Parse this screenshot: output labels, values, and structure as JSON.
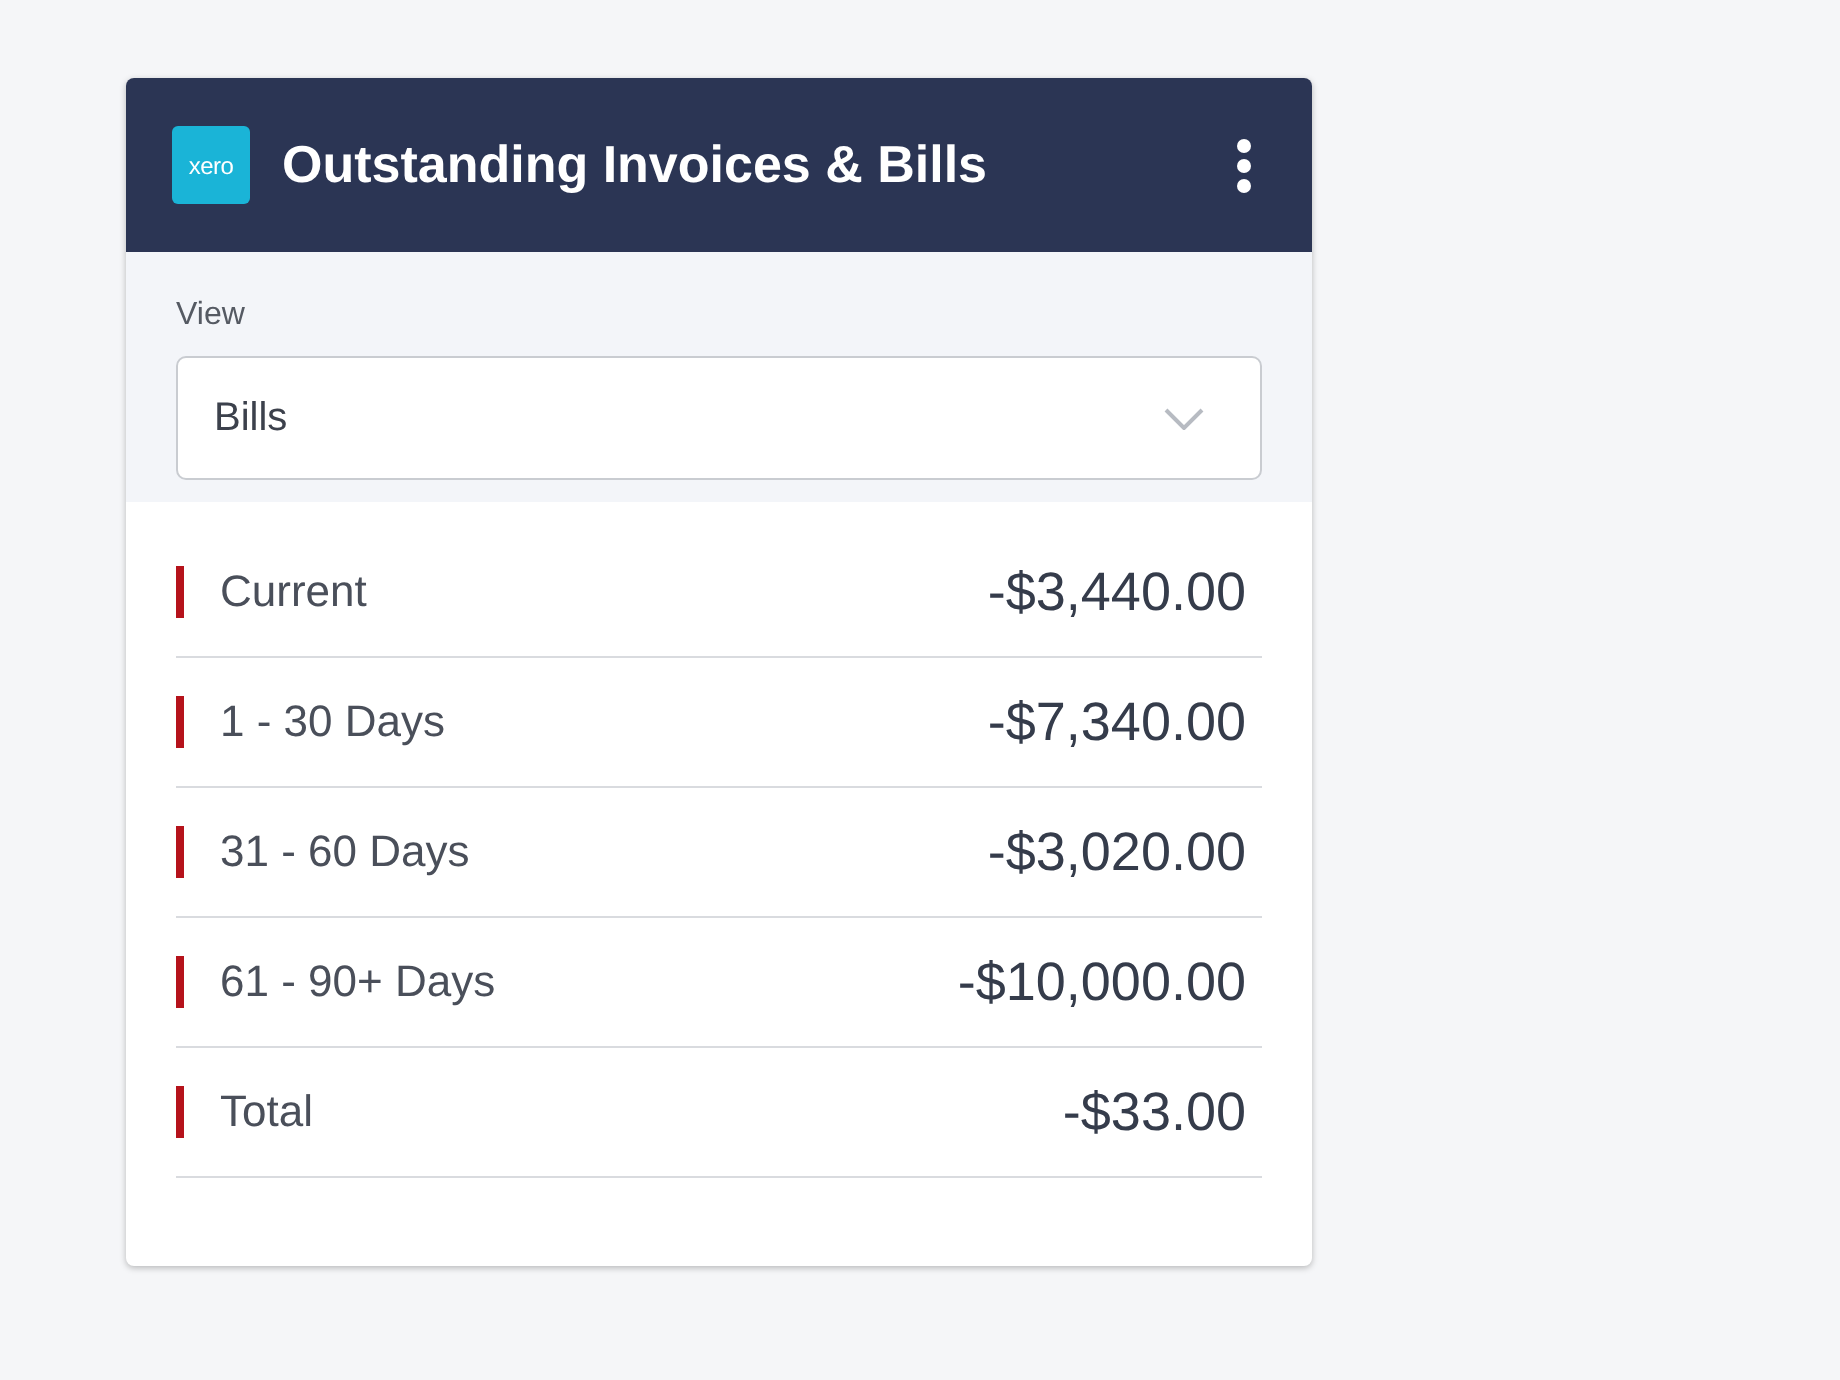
{
  "header": {
    "logo": "xero",
    "title": "Outstanding Invoices & Bills"
  },
  "filter": {
    "label": "View",
    "value": "Bills"
  },
  "rows": [
    {
      "label": "Current",
      "amount": "-$3,440.00"
    },
    {
      "label": "1 - 30 Days",
      "amount": "-$7,340.00"
    },
    {
      "label": "31 - 60 Days",
      "amount": "-$3,020.00"
    },
    {
      "label": "61 - 90+ Days",
      "amount": "-$10,000.00"
    },
    {
      "label": "Total",
      "amount": "-$33.00"
    }
  ]
}
